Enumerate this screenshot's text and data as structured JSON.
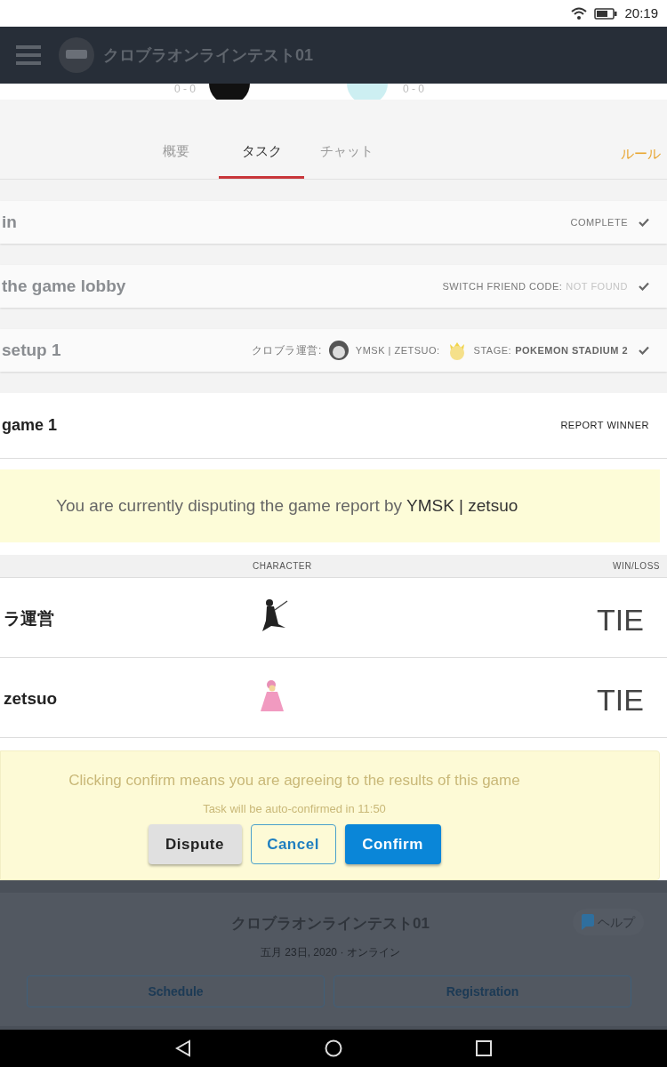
{
  "status_bar": {
    "time": "20:19"
  },
  "header": {
    "title": "クロブラオンラインテスト01"
  },
  "match_strip": {
    "scores": [
      "0 - 0",
      "0 - 0"
    ]
  },
  "tabs": [
    {
      "label": "概要",
      "selected": false
    },
    {
      "label": "タスク",
      "selected": true
    },
    {
      "label": "チャット",
      "selected": false
    }
  ],
  "rules_link": "ルール",
  "tasks": [
    {
      "kind": "status",
      "title": "in",
      "status": "COMPLETE",
      "done": true
    },
    {
      "kind": "friend_code",
      "title": "the game lobby",
      "label": "SWITCH FRIEND CODE:",
      "value": "NOT FOUND",
      "done": true
    },
    {
      "kind": "setup",
      "title": "setup 1",
      "player1": "クロブラ運営:",
      "player2": "YMSK | ZETSUO:",
      "stage_label": "STAGE:",
      "stage": "POKEMON STADIUM 2",
      "done": true
    }
  ],
  "game": {
    "title": "game 1",
    "action": "REPORT WINNER",
    "dispute_notice": "You are currently disputing the game report by **YMSK | zetsuo**",
    "columns": [
      "CHARACTER",
      "WIN/LOSS"
    ],
    "rows": [
      {
        "player": "ラ運営",
        "kind": "dark",
        "result": "TIE"
      },
      {
        "player": "zetsuo",
        "kind": "pink",
        "result": "TIE"
      }
    ],
    "confirm_box": {
      "message": "Clicking confirm means you are agreeing to the results of this game",
      "countdown": "Task will be auto-confirmed in 11:50",
      "buttons": [
        {
          "kind": "dispute",
          "label": "Dispute"
        },
        {
          "kind": "cancel",
          "label": "Cancel"
        },
        {
          "kind": "confirm",
          "label": "Confirm"
        }
      ]
    }
  },
  "footer": {
    "title": "クロブラオンラインテスト01",
    "subtitle": "五月 23日, 2020 · オンライン",
    "help": "ヘルプ",
    "buttons": [
      "Schedule",
      "Registration"
    ]
  }
}
